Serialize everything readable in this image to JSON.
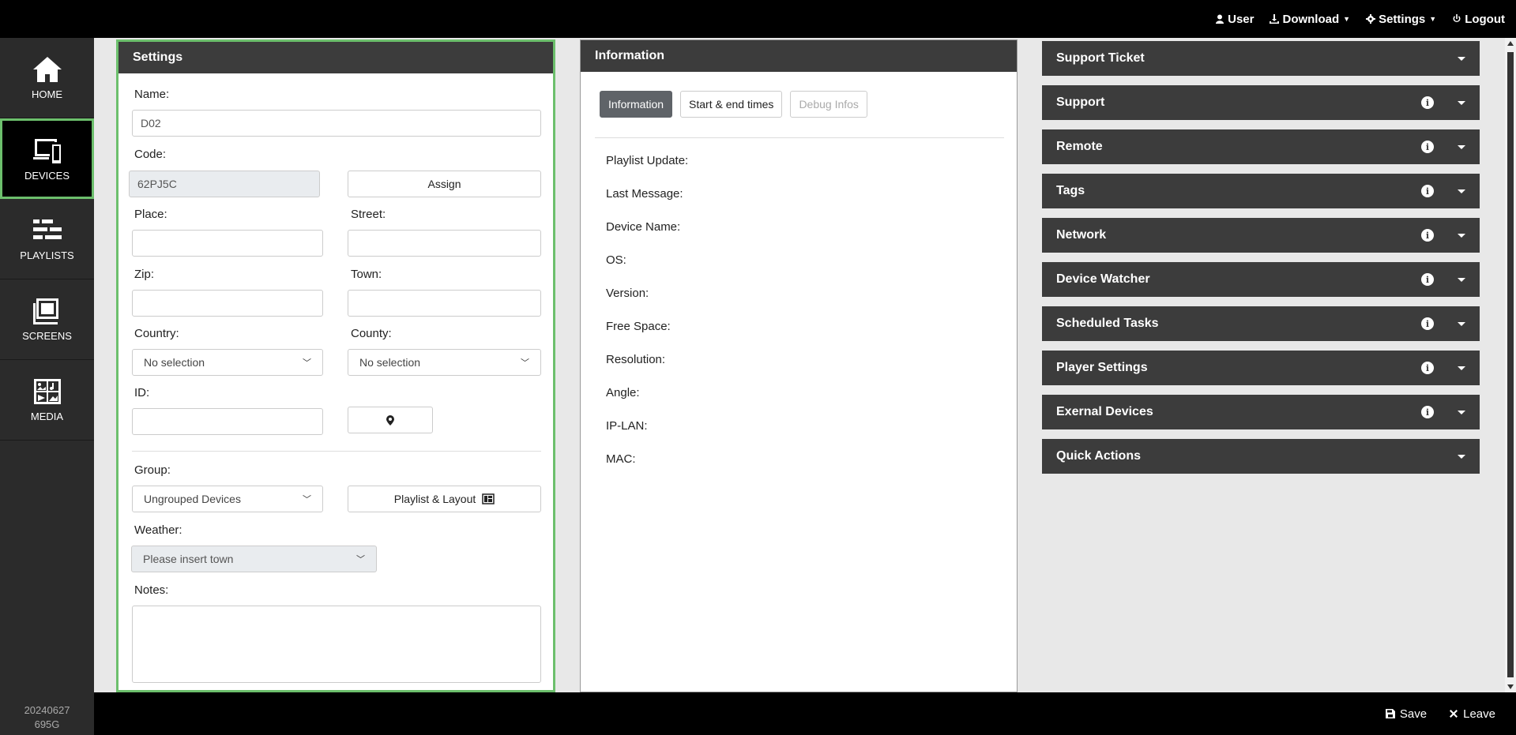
{
  "topnav": {
    "user": "User",
    "download": "Download",
    "settings": "Settings",
    "logout": "Logout"
  },
  "sidebar": {
    "items": [
      {
        "label": "HOME",
        "icon": "home-icon"
      },
      {
        "label": "DEVICES",
        "icon": "devices-icon",
        "active": true
      },
      {
        "label": "PLAYLISTS",
        "icon": "playlists-icon"
      },
      {
        "label": "SCREENS",
        "icon": "screens-icon"
      },
      {
        "label": "MEDIA",
        "icon": "media-icon"
      }
    ],
    "version_line1": "20240627",
    "version_line2": "695G"
  },
  "settings": {
    "title": "Settings",
    "name_label": "Name:",
    "name_value": "D02",
    "code_label": "Code:",
    "code_value": "62PJ5C",
    "assign_label": "Assign",
    "place_label": "Place:",
    "street_label": "Street:",
    "zip_label": "Zip:",
    "town_label": "Town:",
    "country_label": "Country:",
    "country_value": "No selection",
    "county_label": "County:",
    "county_value": "No selection",
    "id_label": "ID:",
    "group_label": "Group:",
    "group_value": "Ungrouped Devices",
    "playlist_layout_label": "Playlist & Layout",
    "weather_label": "Weather:",
    "weather_value": "Please insert town",
    "notes_label": "Notes:"
  },
  "information": {
    "title": "Information",
    "tabs": [
      "Information",
      "Start & end times",
      "Debug Infos"
    ],
    "rows": [
      "Playlist Update:",
      "Last Message:",
      "Device Name:",
      "OS:",
      "Version:",
      "Free Space:",
      "Resolution:",
      "Angle:",
      "IP-LAN:",
      "MAC:"
    ]
  },
  "accordion": {
    "items": [
      {
        "title": "Support Ticket",
        "info": false
      },
      {
        "title": "Support",
        "info": true
      },
      {
        "title": "Remote",
        "info": true
      },
      {
        "title": "Tags",
        "info": true
      },
      {
        "title": "Network",
        "info": true
      },
      {
        "title": "Device Watcher",
        "info": true
      },
      {
        "title": "Scheduled Tasks",
        "info": true
      },
      {
        "title": "Player Settings",
        "info": true
      },
      {
        "title": "Exernal Devices",
        "info": true
      },
      {
        "title": "Quick Actions",
        "info": false
      }
    ]
  },
  "bottombar": {
    "save": "Save",
    "leave": "Leave"
  },
  "colors": {
    "accent_green": "#6cbf6c",
    "header_dark": "#3c3c3c",
    "sidebar_bg": "#2b2b2b"
  }
}
